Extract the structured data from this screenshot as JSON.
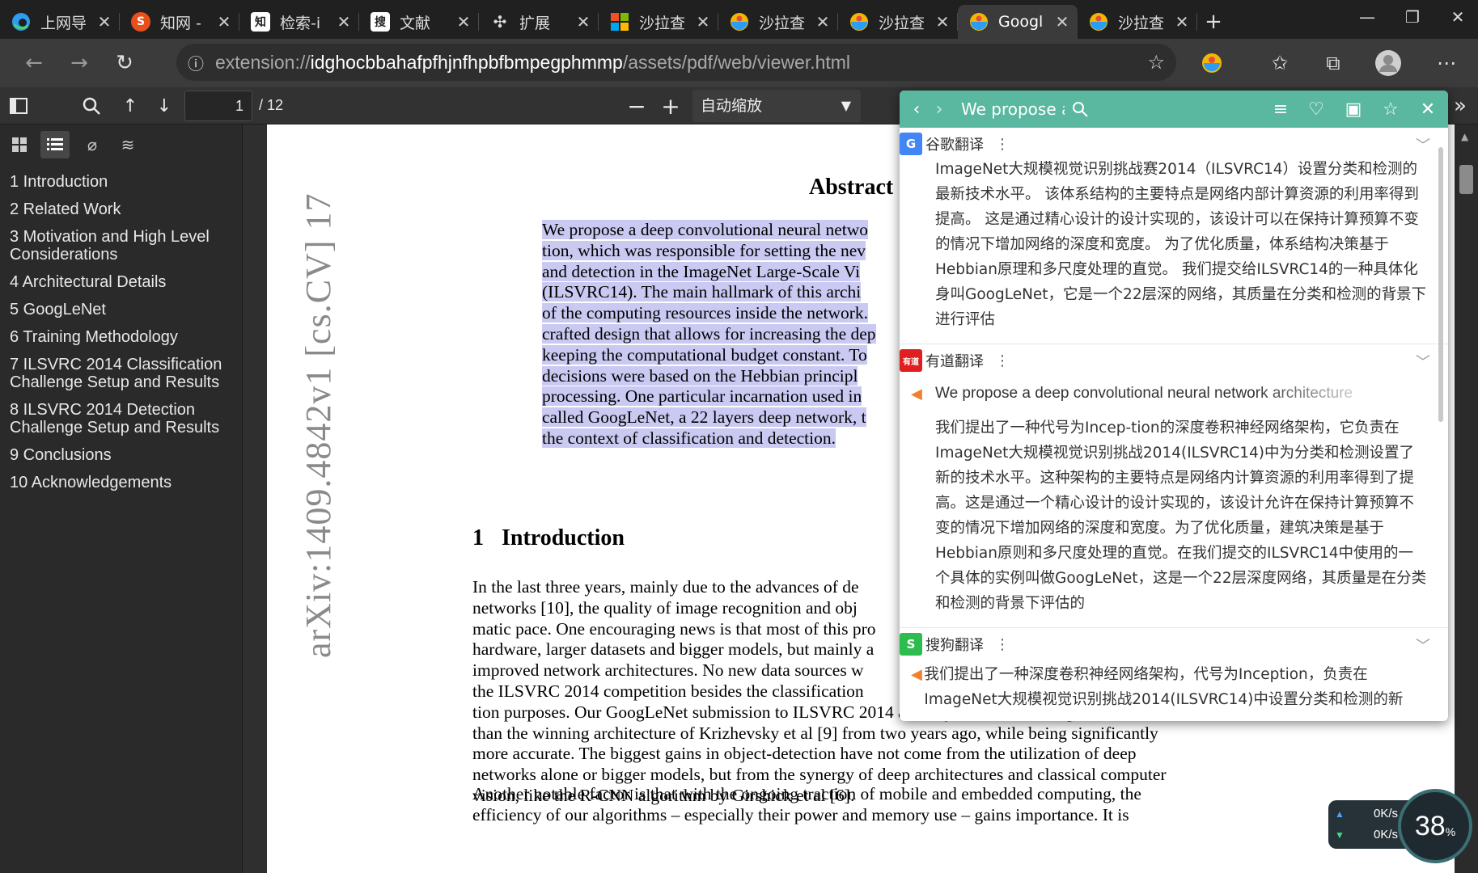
{
  "browser": {
    "tabs": [
      {
        "label": "上网导",
        "icon": "edge-icon",
        "color": "#1a73e8",
        "active": false
      },
      {
        "label": "知网 -",
        "icon": "cnki-s-icon",
        "color": "#e8501b",
        "active": false
      },
      {
        "label": "检索-i",
        "icon": "zhi-icon",
        "color": "#444444",
        "active": false
      },
      {
        "label": "文献",
        "icon": "sou-icon",
        "color": "#ffffff",
        "active": false
      },
      {
        "label": "扩展",
        "icon": "puzzle-icon",
        "color": "#dddddd",
        "active": false
      },
      {
        "label": "沙拉查",
        "icon": "windows-icon",
        "color": "#f25022",
        "active": false
      },
      {
        "label": "沙拉查",
        "icon": "saladict-icon",
        "color": "#f2b705",
        "active": false
      },
      {
        "label": "沙拉查",
        "icon": "saladict-icon",
        "color": "#f2b705",
        "active": false
      },
      {
        "label": "Googl",
        "icon": "saladict-icon",
        "color": "#f2b705",
        "active": true
      },
      {
        "label": "沙拉查",
        "icon": "saladict-icon",
        "color": "#f2b705",
        "active": false
      }
    ],
    "url_prefix": "extension://",
    "url_host": "idghocbbahafpfhjnfhpbfbmpegphmmp",
    "url_path": "/assets/pdf/web/viewer.html"
  },
  "pdf_toolbar": {
    "page_value": "1",
    "page_count": "/ 12",
    "zoom_label": "自动缩放"
  },
  "outline": [
    "1 Introduction",
    "2 Related Work",
    "3 Motivation and High Level Considerations",
    "4 Architectural Details",
    "5 GoogLeNet",
    "6 Training Methodology",
    "7 ILSVRC 2014 Classification Challenge Setup and Results",
    "8 ILSVRC 2014 Detection Challenge Setup and Results",
    "9 Conclusions",
    "10 Acknowledgements"
  ],
  "page": {
    "arxiv_stamp": "arXiv:1409.4842v1  [cs.CV]  17",
    "abstract_title": "Abstract",
    "abstract_lines": [
      "We propose a deep convolutional neural netwo",
      "tion, which was responsible for setting the nev",
      "and detection in the ImageNet Large-Scale Vi",
      "(ILSVRC14). The main hallmark of this archi",
      "of the computing resources inside the network.",
      "crafted design that allows for increasing the dep",
      "keeping the computational budget constant. To",
      "decisions were based on the Hebbian principl",
      "processing. One particular incarnation used in",
      "called GoogLeNet, a 22 layers deep network, t",
      "the context of classification and detection."
    ],
    "section_number": "1",
    "section_title": "Introduction",
    "intro_lines": [
      "In the last three years, mainly due to the advances of de",
      "networks  [10], the quality of image recognition and obj",
      "matic pace. One encouraging news is that most of this pro",
      "hardware, larger datasets and bigger models, but mainly a",
      "improved network architectures. No new data sources w",
      "the ILSVRC 2014 competition besides the classification",
      "tion purposes.  Our GoogLeNet submission to ILSVRC 2014 actually uses 12× fewer parameters",
      "than the winning architecture of Krizhevsky et al [9] from two years ago, while being significantly",
      "more accurate.  The biggest gains in object-detection have not come from the utilization of deep",
      "networks alone or bigger models, but from the synergy of deep architectures and classical computer",
      "vision, like the R-CNN algorithm by Girshick et al [6]."
    ],
    "para2_lines": [
      "Another notable factor is that with the ongoing traction of mobile and embedded computing, the",
      "efficiency of our algorithms – especially their power and memory use – gains importance.  It is"
    ]
  },
  "popup": {
    "search_text": "We propose a",
    "engines": [
      {
        "name": "谷歌翻译",
        "logo": "G",
        "logo_color": "#4285f4",
        "source": "",
        "text": "ImageNet大规模视觉识别挑战赛2014（ILSVRC14）设置分类和检测的最新技术水平。 该体系结构的主要特点是网络内部计算资源的利用率得到提高。 这是通过精心设计的设计实现的，该设计可以在保持计算预算不变的情况下增加网络的深度和宽度。 为了优化质量，体系结构决策基于Hebbian原理和多尺度处理的直觉。 我们提交给ILSVRC14的一种具体化身叫GoogLeNet，它是一个22层深的网络，其质量在分类和检测的背景下进行评估"
      },
      {
        "name": "有道翻译",
        "logo": "有道",
        "logo_color": "#e02020",
        "source": "We propose a deep convolutional neural network architecture",
        "text": "我们提出了一种代号为Incep-tion的深度卷积神经网络架构，它负责在ImageNet大规模视觉识别挑战2014(ILSVRC14)中为分类和检测设置了新的技术水平。这种架构的主要特点是网络内计算资源的利用率得到了提高。这是通过一个精心设计的设计实现的，该设计允许在保持计算预算不变的情况下增加网络的深度和宽度。为了优化质量，建筑决策是基于Hebbian原则和多尺度处理的直觉。在我们提交的ILSVRC14中使用的一个具体的实例叫做GoogLeNet，这是一个22层深度网络，其质量是在分类和检测的背景下评估的"
      },
      {
        "name": "搜狗翻译",
        "logo": "S",
        "logo_color": "#2dbd4e",
        "source": "",
        "text": "我们提出了一种深度卷积神经网络架构，代号为Inception，负责在ImageNet大规模视觉识别挑战2014(ILSVRC14)中设置分类和检测的新"
      }
    ]
  },
  "speed": {
    "up": "0K/s",
    "down": "0K/s",
    "cpu": "38",
    "cpu_unit": "%"
  }
}
